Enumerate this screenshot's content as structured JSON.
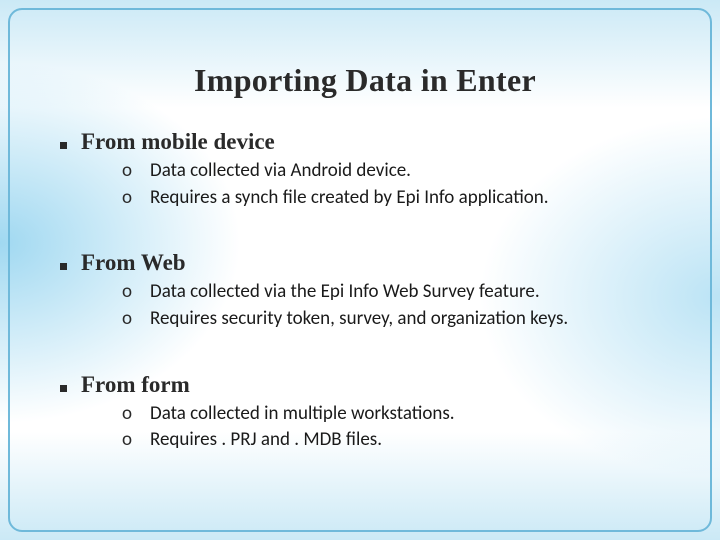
{
  "title": "Importing Data in Enter",
  "sections": [
    {
      "heading": "From mobile device",
      "items": [
        "Data collected via Android device.",
        "Requires a synch file created by Epi Info application."
      ]
    },
    {
      "heading": "From Web",
      "items": [
        "Data collected via the Epi Info Web Survey feature.",
        "Requires security token, survey,  and organization keys."
      ]
    },
    {
      "heading": "From form",
      "items": [
        "Data collected in multiple workstations.",
        "Requires . PRJ and . MDB files."
      ]
    }
  ]
}
